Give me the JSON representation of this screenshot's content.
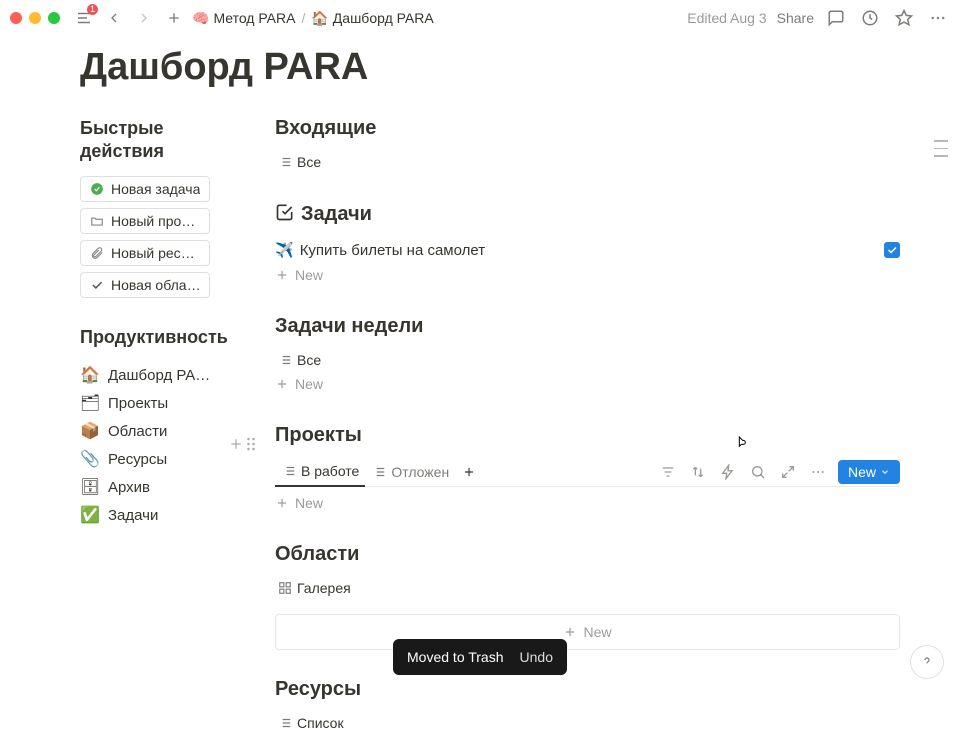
{
  "topbar": {
    "sidebar_badge": "1",
    "breadcrumb": [
      {
        "icon": "🧠",
        "label": "Метод PARA"
      },
      {
        "icon": "🏠",
        "label": "Дашборд PARA"
      }
    ],
    "edited": "Edited Aug 3",
    "share": "Share"
  },
  "page": {
    "title": "Дашборд PARA"
  },
  "quick": {
    "heading1": "Быстрые",
    "heading2": "действия",
    "actions": [
      {
        "icon": "check-circle",
        "label": "Новая задача"
      },
      {
        "icon": "folder",
        "label": "Новый проект"
      },
      {
        "icon": "paperclip",
        "label": "Новый ресу…"
      },
      {
        "icon": "checkmark",
        "label": "Новая обла…"
      }
    ]
  },
  "productivity": {
    "heading": "Продуктивность",
    "links": [
      {
        "emoji": "🏠",
        "label": "Дашборд PA…"
      },
      {
        "emoji": "🗂",
        "label": "Проекты"
      },
      {
        "emoji": "📦",
        "label": "Области"
      },
      {
        "emoji": "📎",
        "label": "Ресурсы"
      },
      {
        "emoji": "🗄",
        "label": "Архив"
      },
      {
        "emoji": "✅",
        "label": "Задачи"
      }
    ]
  },
  "inbox": {
    "heading": "Входящие",
    "view": "Все"
  },
  "tasks": {
    "icon": "📝",
    "heading": "Задачи",
    "items": [
      {
        "emoji": "✈️",
        "label": "Купить билеты на самолет",
        "checked": true
      }
    ],
    "new": "New"
  },
  "week": {
    "heading": "Задачи недели",
    "view": "Все",
    "new": "New"
  },
  "projects": {
    "heading": "Проекты",
    "tabs": [
      {
        "label": "В работе",
        "active": true
      },
      {
        "label": "Отложен",
        "active": false
      }
    ],
    "new_btn": "New",
    "new_row": "New"
  },
  "areas": {
    "heading": "Области",
    "view": "Галерея",
    "new": "New"
  },
  "resources": {
    "heading": "Ресурсы",
    "view": "Список"
  },
  "toast": {
    "message": "Moved to Trash",
    "undo": "Undo"
  }
}
